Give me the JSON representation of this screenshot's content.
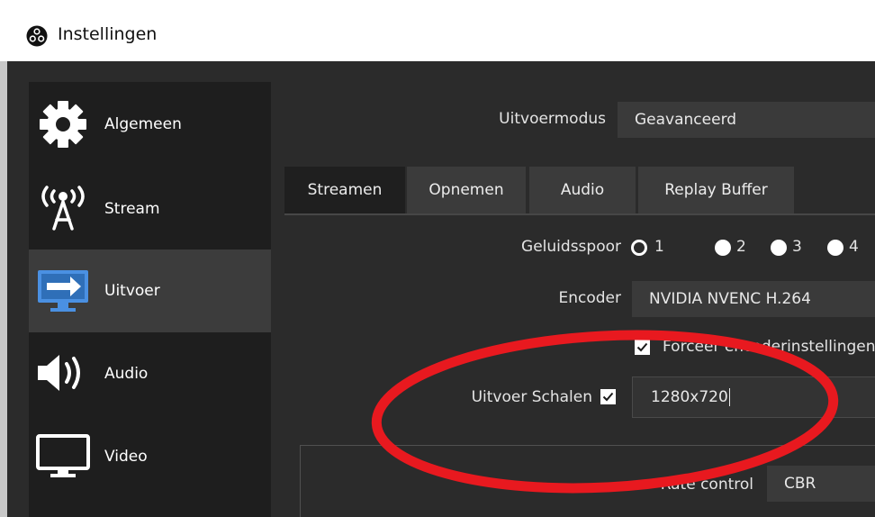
{
  "window": {
    "title": "Instellingen"
  },
  "sidebar": {
    "items": [
      {
        "label": "Algemeen",
        "icon": "gear-icon"
      },
      {
        "label": "Stream",
        "icon": "antenna-icon"
      },
      {
        "label": "Uitvoer",
        "icon": "output-monitor-icon",
        "selected": true
      },
      {
        "label": "Audio",
        "icon": "speaker-icon"
      },
      {
        "label": "Video",
        "icon": "monitor-icon"
      }
    ]
  },
  "output_mode": {
    "label": "Uitvoermodus",
    "value": "Geavanceerd"
  },
  "tabs": [
    {
      "label": "Streamen",
      "active": true
    },
    {
      "label": "Opnemen"
    },
    {
      "label": "Audio"
    },
    {
      "label": "Replay Buffer"
    }
  ],
  "streaming": {
    "audio_track": {
      "label": "Geluidsspoor",
      "options": [
        "1",
        "2",
        "3",
        "4"
      ],
      "selected": "1"
    },
    "encoder": {
      "label": "Encoder",
      "value": "NVIDIA NVENC H.264"
    },
    "enforce_encoder_settings": {
      "label": "Forceer encoderinstellingen",
      "checked": true
    },
    "rescale_output": {
      "label": "Uitvoer Schalen",
      "checked": true,
      "value": "1280x720"
    },
    "rate_control": {
      "label": "Rate control",
      "value": "CBR"
    }
  },
  "annotation": {
    "shape": "ellipse",
    "color": "#e8191f"
  },
  "colors": {
    "background": "#2b2b2b",
    "sidebar": "#1e1e1e",
    "sidebar_selected": "#3c3c3c",
    "tab_active": "#1f1f1f",
    "tab": "#3b3b3b",
    "annotation": "#e8191f"
  }
}
